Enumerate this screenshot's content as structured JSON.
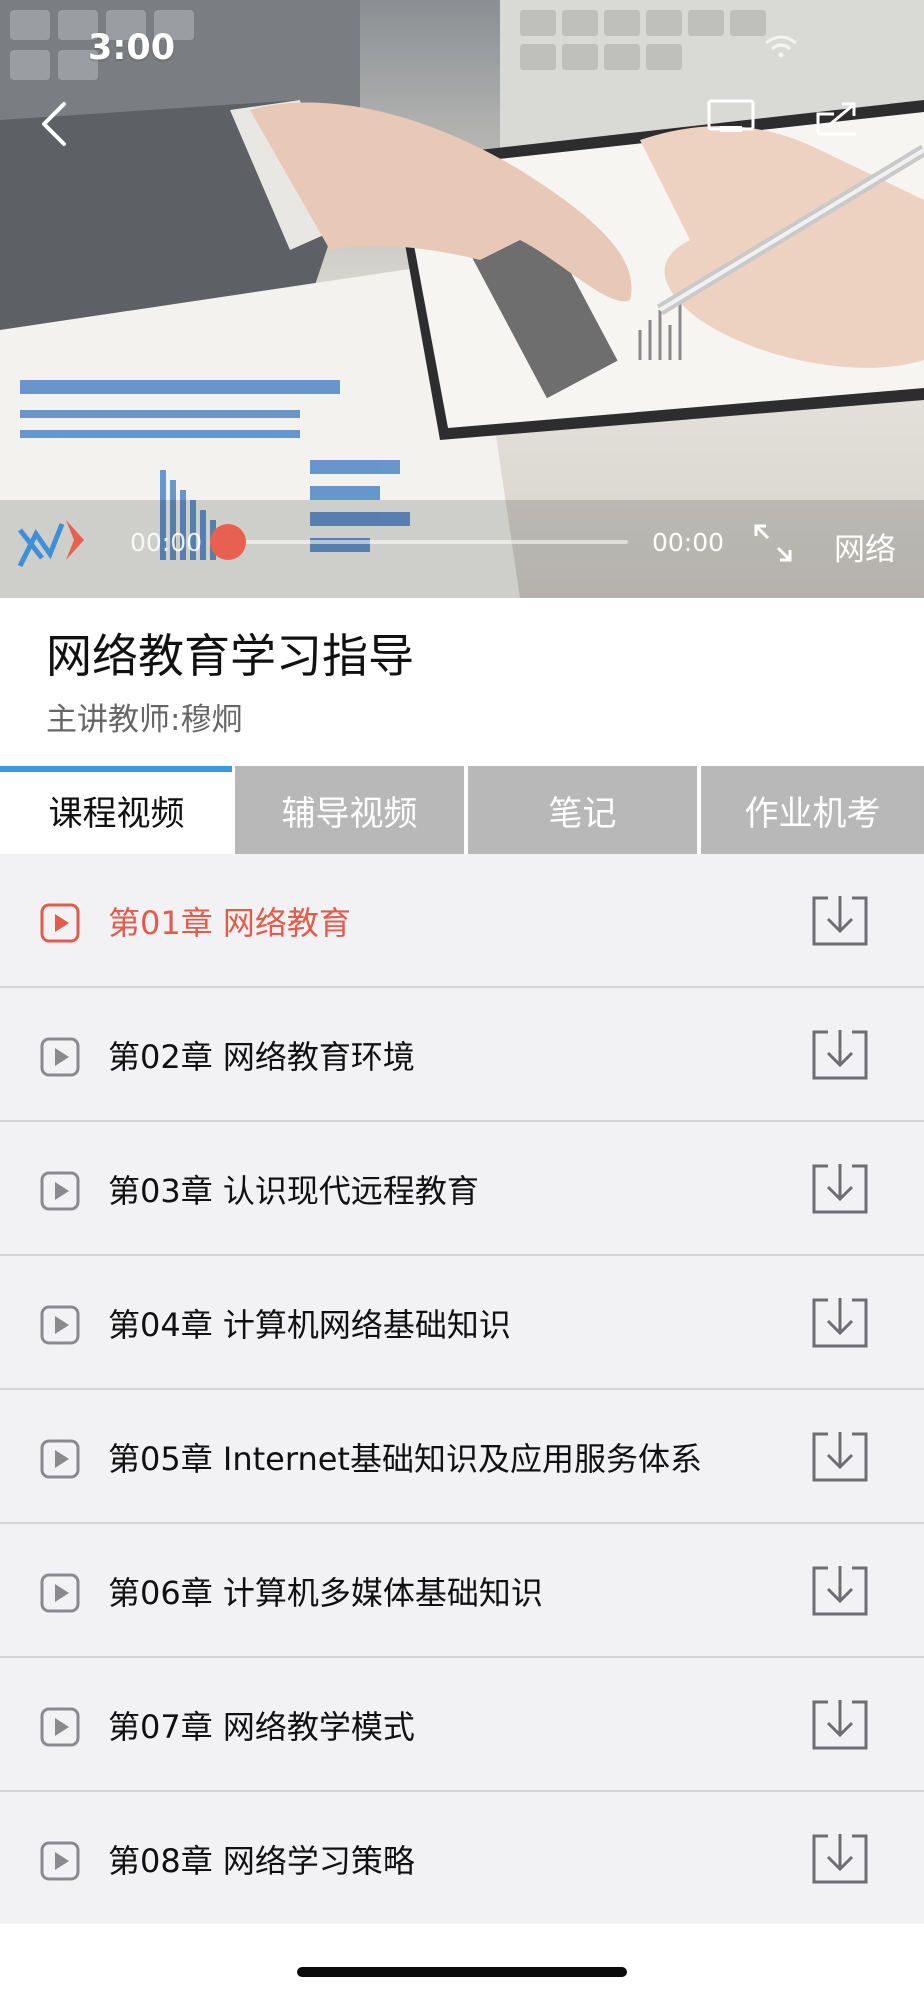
{
  "status": {
    "time": "3:00"
  },
  "player": {
    "current_time": "00:00",
    "total_time": "00:00",
    "progress": 0,
    "net_label": "网络"
  },
  "course": {
    "title": "网络教育学习指导",
    "teacher": "主讲教师:穆炯"
  },
  "tabs": [
    {
      "label": "课程视频",
      "active": true
    },
    {
      "label": "辅导视频",
      "active": false
    },
    {
      "label": "笔记",
      "active": false
    },
    {
      "label": "作业机考",
      "active": false
    }
  ],
  "chapters": [
    {
      "label": "第01章  网络教育",
      "active": true
    },
    {
      "label": "第02章 网络教育环境",
      "active": false
    },
    {
      "label": "第03章 认识现代远程教育",
      "active": false
    },
    {
      "label": "第04章 计算机网络基础知识",
      "active": false
    },
    {
      "label": "第05章 Internet基础知识及应用服务体系",
      "active": false
    },
    {
      "label": "第06章 计算机多媒体基础知识",
      "active": false
    },
    {
      "label": "第07章 网络教学模式",
      "active": false
    },
    {
      "label": "第08章 网络学习策略",
      "active": false
    }
  ],
  "colors": {
    "accent": "#e25b4b",
    "tab_indicator": "#3a9ad9",
    "tab_inactive_bg": "#b8b8b8",
    "list_bg": "#f2f2f5"
  },
  "icons": {
    "back": "chevron-left-icon",
    "cast": "cast-icon",
    "share": "share-icon",
    "fullscreen": "expand-icon",
    "play": "play-icon",
    "download": "download-icon"
  }
}
